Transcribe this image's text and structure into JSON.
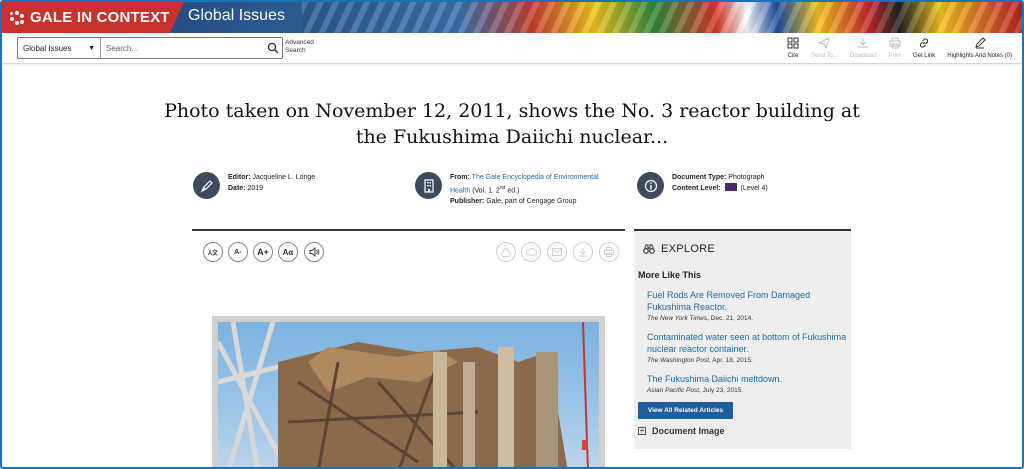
{
  "header": {
    "brand": "GALE IN CONTEXT",
    "product": "Global Issues",
    "brand_color": "#c8322c"
  },
  "toolbar": {
    "scope_value": "Global Issues",
    "search_placeholder": "Search...",
    "advanced_search": "Advanced Search",
    "tools": [
      {
        "label": "Cite",
        "icon": "cite-icon",
        "enabled": true
      },
      {
        "label": "Send To...",
        "icon": "send-icon",
        "enabled": false
      },
      {
        "label": "Download",
        "icon": "download-icon",
        "enabled": false
      },
      {
        "label": "Print",
        "icon": "print-icon",
        "enabled": false
      },
      {
        "label": "Get Link",
        "icon": "link-icon",
        "enabled": true
      },
      {
        "label": "Highlights And Notes (0)",
        "icon": "pen-icon",
        "enabled": true
      }
    ]
  },
  "document": {
    "title": "Photo taken on November 12, 2011, shows the No. 3 reactor building at the Fukushima Daiichi nuclear...",
    "editor_label": "Editor:",
    "editor": "Jacqueline L. Longe",
    "date_label": "Date:",
    "date": "2019",
    "from_label": "From:",
    "from_link": "The Gale Encyclopedia of Environmental Health",
    "from_vol_pre": "(Vol. 1. 2",
    "from_vol_sup": "nd",
    "from_vol_post": " ed.)",
    "publisher_label": "Publisher:",
    "publisher": "Gale, part of Cengage Group",
    "doctype_label": "Document Type:",
    "doctype": "Photograph",
    "level_label": "Content Level:",
    "level": "(Level 4)"
  },
  "explore": {
    "heading": "EXPLORE",
    "more_like_this": "More Like This",
    "items": [
      {
        "title": "Fuel Rods Are Removed From Damaged Fukushima Reactor.",
        "source": "The New York Times",
        "date": ", Dec. 21, 2014."
      },
      {
        "title": "Contaminated water seen at bottom of Fukushima nuclear reactor container.",
        "source": "The Washington Post",
        "date": ", Apr. 18, 2015."
      },
      {
        "title": "The Fukushima Daiichi meltdown.",
        "source": "Asian Pacific Post",
        "date": ", July 23, 2015."
      }
    ],
    "view_all": "View All Related Articles",
    "document_image": "Document Image"
  },
  "reader_controls": {
    "translate_label": "A文",
    "font_smaller": "A-",
    "font_larger": "A+",
    "font_style": "Aα"
  }
}
